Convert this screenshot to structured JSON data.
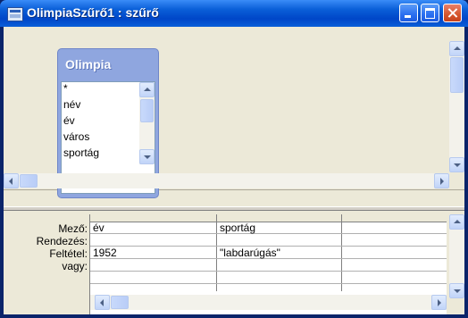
{
  "window": {
    "title": "OlimpiaSzűrő1 : szűrő"
  },
  "table": {
    "name": "Olimpia",
    "fields": [
      "*",
      "név",
      "év",
      "város",
      "sportág"
    ]
  },
  "grid": {
    "row_labels": {
      "field": "Mező:",
      "sort": "Rendezés:",
      "criteria": "Feltétel:",
      "or": "vagy:"
    },
    "columns": [
      {
        "field": "év",
        "sort": "",
        "criteria": "1952",
        "or": ""
      },
      {
        "field": "sportág",
        "sort": "",
        "criteria": "\"labdarúgás\"",
        "or": ""
      },
      {
        "field": "",
        "sort": "",
        "criteria": "",
        "or": ""
      }
    ]
  },
  "icons": [
    "app-icon",
    "minimize-icon",
    "maximize-icon",
    "close-icon",
    "scroll-up-icon",
    "scroll-down-icon",
    "scroll-left-icon",
    "scroll-right-icon"
  ]
}
